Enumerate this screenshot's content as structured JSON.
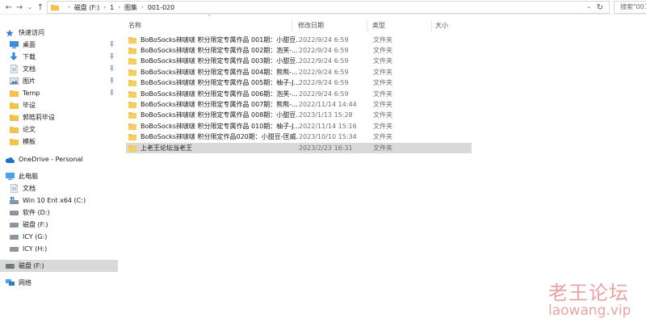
{
  "address_bar": {
    "breadcrumbs": [
      "磁盘 (F:)",
      "1",
      "图集",
      "001-020"
    ],
    "search_placeholder": "搜索\"001"
  },
  "nav_pane": {
    "quick_access": {
      "label": "快速访问",
      "items": [
        {
          "label": "桌面",
          "icon": "desktop-icon",
          "pinned": true
        },
        {
          "label": "下载",
          "icon": "download-icon",
          "pinned": true
        },
        {
          "label": "文档",
          "icon": "document-icon",
          "pinned": true
        },
        {
          "label": "图片",
          "icon": "picture-icon",
          "pinned": true
        },
        {
          "label": "Temp",
          "icon": "folder-icon",
          "pinned": true
        },
        {
          "label": "毕设",
          "icon": "folder-icon",
          "pinned": false
        },
        {
          "label": "郭皓莉毕设",
          "icon": "folder-icon",
          "pinned": false
        },
        {
          "label": "论文",
          "icon": "folder-icon",
          "pinned": false
        },
        {
          "label": "模板",
          "icon": "folder-icon",
          "pinned": false
        }
      ]
    },
    "onedrive": {
      "label": "OneDrive - Personal"
    },
    "this_pc": {
      "label": "此电脑",
      "items": [
        {
          "label": "文档",
          "icon": "document-icon"
        },
        {
          "label": "Win 10 Ent x64 (C:)",
          "icon": "windows-drive-icon"
        },
        {
          "label": "软件 (D:)",
          "icon": "drive-icon"
        },
        {
          "label": "磁盘 (F:)",
          "icon": "drive-icon"
        },
        {
          "label": "ICY (G:)",
          "icon": "drive-icon"
        },
        {
          "label": "ICY (H:)",
          "icon": "drive-icon"
        }
      ]
    },
    "drive_f": {
      "label": "磁盘 (F:)"
    },
    "network": {
      "label": "网络"
    }
  },
  "columns": {
    "name": "名称",
    "date": "修改日期",
    "type": "类型",
    "size": "大小"
  },
  "files": [
    {
      "name": "BoBoSocks袜啵啵 积分限定专属作品 001期：小甜豆...",
      "date": "2022/9/24 6:59",
      "type": "文件夹"
    },
    {
      "name": "BoBoSocks袜啵啵 积分限定专属作品 002期：泡芙-...",
      "date": "2022/9/24 6:59",
      "type": "文件夹"
    },
    {
      "name": "BoBoSocks袜啵啵 积分限定专属作品 003期：小甜豆...",
      "date": "2022/9/24 6:59",
      "type": "文件夹"
    },
    {
      "name": "BoBoSocks袜啵啵 积分限定专属作品 004期：熊熊-...",
      "date": "2022/9/24 6:59",
      "type": "文件夹"
    },
    {
      "name": "BoBoSocks袜啵啵 积分限定专属作品 005期：柚子-J...",
      "date": "2022/9/24 6:59",
      "type": "文件夹"
    },
    {
      "name": "BoBoSocks袜啵啵 积分限定专属作品 006期：泡芙-...",
      "date": "2022/9/24 6:59",
      "type": "文件夹"
    },
    {
      "name": "BoBoSocks袜啵啵 积分限定专属作品 007期：熊熊-...",
      "date": "2022/11/14 14:44",
      "type": "文件夹"
    },
    {
      "name": "BoBoSocks袜啵啵 积分限定专属作品 008期：小甜豆...",
      "date": "2023/1/13 15:28",
      "type": "文件夹"
    },
    {
      "name": "BoBoSocks袜啵啵 积分限定专属作品 010期：柚子-J...",
      "date": "2022/11/14 15:16",
      "type": "文件夹"
    },
    {
      "name": "BoBoSocks袜啵啵 积分限定作品020期：小甜豆-匡威...",
      "date": "2023/10/10 15:34",
      "type": "文件夹"
    },
    {
      "name": "上老王论坛当老王",
      "date": "2023/2/23 16:31",
      "type": "文件夹"
    }
  ],
  "watermark": {
    "line1": "老王论坛",
    "line2": "laowang.vip"
  },
  "colors": {
    "folder": "#f4c14a",
    "folder_dark": "#e0a72a",
    "selection": "#d9d9d9",
    "pin": "#5b8fd0",
    "watermark": "#e8a4a4"
  }
}
